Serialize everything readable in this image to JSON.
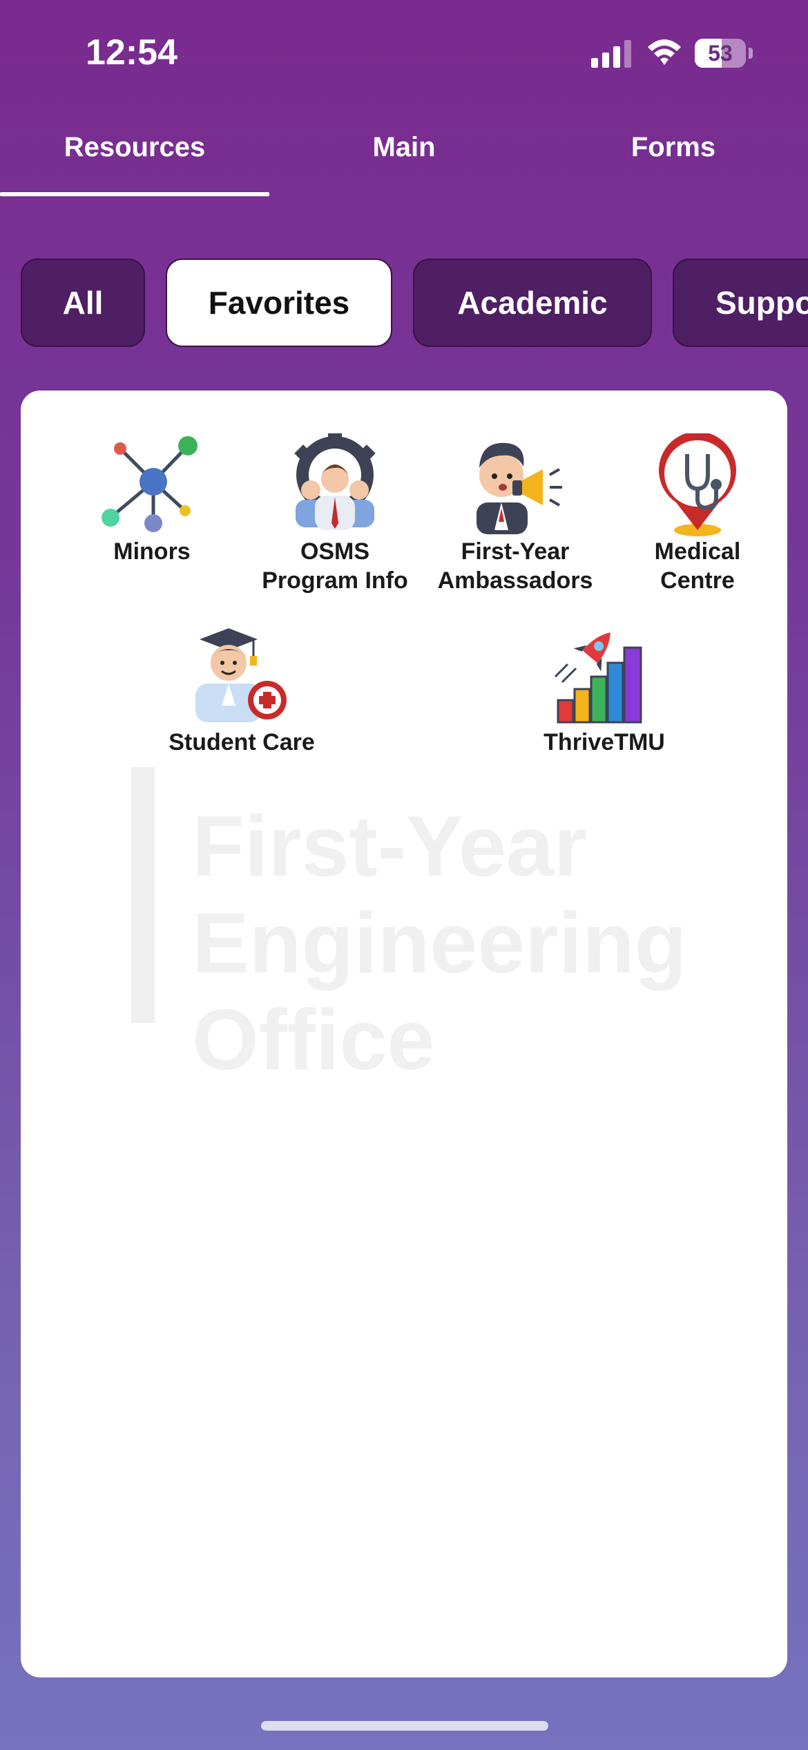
{
  "status_bar": {
    "time": "12:54",
    "battery": "53",
    "battery_fraction": 0.53
  },
  "top_tabs": [
    {
      "label": "Resources",
      "selected": true
    },
    {
      "label": "Main",
      "selected": false
    },
    {
      "label": "Forms",
      "selected": false
    }
  ],
  "filter_chips": [
    {
      "label": "All",
      "selected": false
    },
    {
      "label": "Favorites",
      "selected": true
    },
    {
      "label": "Academic",
      "selected": false
    },
    {
      "label": "Suppo",
      "selected": false
    }
  ],
  "tiles": [
    {
      "label": "Minors",
      "icon": "network-icon"
    },
    {
      "label": "OSMS\nProgram Info",
      "icon": "team-gear-icon"
    },
    {
      "label": "First-Year\nAmbassadors",
      "icon": "megaphone-person-icon"
    },
    {
      "label": "Medical\nCentre",
      "icon": "stethoscope-pin-icon"
    },
    {
      "label": "Student Care",
      "icon": "graduate-care-icon"
    },
    {
      "label": "ThriveTMU",
      "icon": "rocket-growth-chart-icon"
    }
  ],
  "watermark": {
    "text": "First-Year\nEngineering\nOffice"
  },
  "colors": {
    "purple_top": "#7a2a8e",
    "purple_bottom": "#7672bf",
    "chip_bg": "#4e1f63",
    "chip_active_bg": "#ffffff"
  }
}
